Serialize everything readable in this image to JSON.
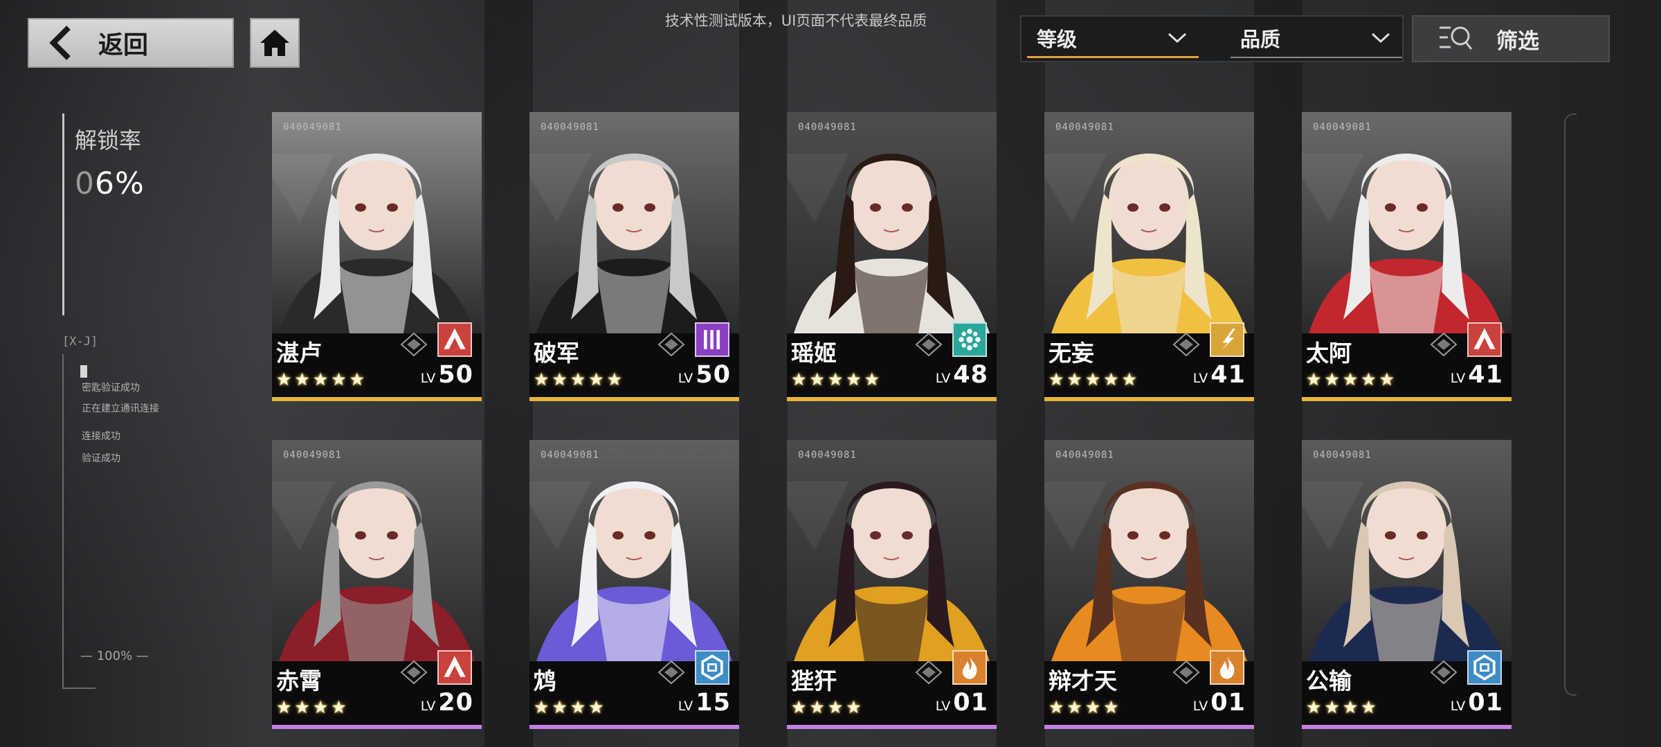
{
  "header": {
    "back_label": "返回",
    "notice": "技术性测试版本，UI页面不代表最终品质"
  },
  "sort": {
    "primary": "等级",
    "secondary": "品质",
    "filter_label": "筛选"
  },
  "unlock": {
    "title": "解锁率",
    "value_dim": "0",
    "value_main": "6%"
  },
  "log": {
    "tag": "[X-J]",
    "lines": [
      "密匙验证成功",
      "正在建立通讯连接",
      "连接成功",
      "验证成功"
    ],
    "percent": "— 100% —"
  },
  "colors": {
    "gold_rarity": "#e6b33a",
    "purple_rarity": "#c77ee0",
    "class_red": "#c9423c",
    "class_purple": "#8b3fc2",
    "class_teal": "#2aa79a",
    "class_gold": "#d9a43a",
    "class_blue": "#3d8cc6",
    "class_orange": "#d9822e"
  },
  "cards": [
    {
      "code": "040049081",
      "name": "湛卢",
      "stars": "★★★★★",
      "lv_prefix": "LV",
      "level": "50",
      "class_icon": "triangle-class-icon",
      "rarity": "gold"
    },
    {
      "code": "040049081",
      "name": "破军",
      "stars": "★★★★★",
      "lv_prefix": "LV",
      "level": "50",
      "class_icon": "bars-class-icon",
      "rarity": "gold"
    },
    {
      "code": "040049081",
      "name": "瑶姬",
      "stars": "★★★★★",
      "lv_prefix": "LV",
      "level": "48",
      "class_icon": "flower-class-icon",
      "rarity": "gold"
    },
    {
      "code": "040049081",
      "name": "无妄",
      "stars": "★★★★★",
      "lv_prefix": "LV",
      "level": "41",
      "class_icon": "slash-class-icon",
      "rarity": "gold"
    },
    {
      "code": "040049081",
      "name": "太阿",
      "stars": "★★★★★",
      "lv_prefix": "LV",
      "level": "41",
      "class_icon": "triangle-class-icon",
      "rarity": "gold"
    },
    {
      "code": "040049081",
      "name": "赤霄",
      "stars": "★★★★",
      "lv_prefix": "LV",
      "level": "20",
      "class_icon": "triangle-class-icon",
      "rarity": "purple"
    },
    {
      "code": "040049081",
      "name": "鸩",
      "stars": "★★★★",
      "lv_prefix": "LV",
      "level": "15",
      "class_icon": "hex-class-icon",
      "rarity": "purple"
    },
    {
      "code": "040049081",
      "name": "狴犴",
      "stars": "★★★★",
      "lv_prefix": "LV",
      "level": "01",
      "class_icon": "flame-class-icon",
      "rarity": "purple"
    },
    {
      "code": "040049081",
      "name": "辩才天",
      "stars": "★★★★",
      "lv_prefix": "LV",
      "level": "01",
      "class_icon": "flame-class-icon",
      "rarity": "purple"
    },
    {
      "code": "040049081",
      "name": "公输",
      "stars": "★★★★",
      "lv_prefix": "LV",
      "level": "01",
      "class_icon": "hex-class-icon",
      "rarity": "purple"
    }
  ]
}
